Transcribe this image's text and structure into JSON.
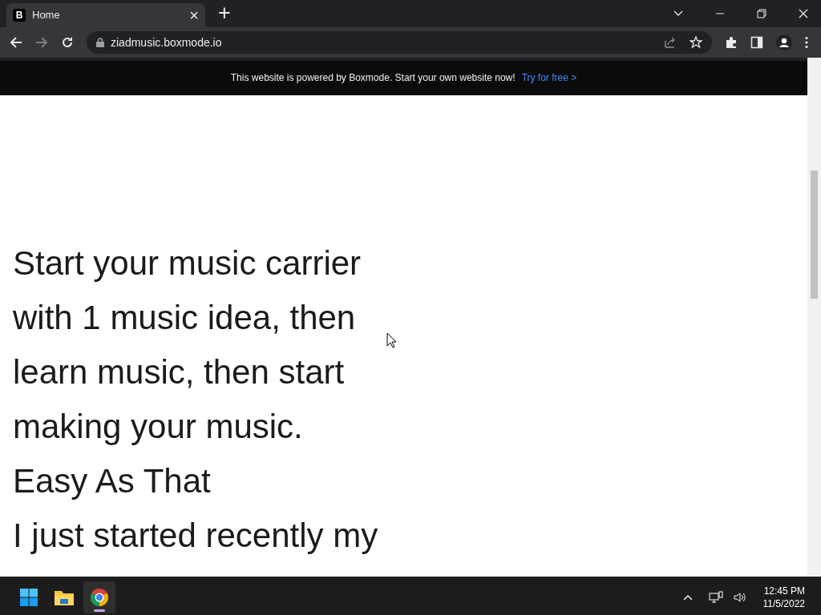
{
  "browser": {
    "tab": {
      "favicon": "B",
      "title": "Home",
      "close": "×"
    },
    "new_tab": "+",
    "url": "ziadmusic.boxmode.io"
  },
  "banner": {
    "text": "This website is powered by Boxmode. Start your own website now!",
    "link": "Try for free >"
  },
  "content": {
    "paragraphs": [
      "Start your music carrier with 1 music idea, then learn music, then start making your music. Easy As That",
      "I just started recently my"
    ]
  },
  "taskbar": {
    "apps": [
      {
        "kind": "start",
        "selected": false
      },
      {
        "kind": "folder",
        "selected": false
      },
      {
        "kind": "browser",
        "selected": true
      }
    ],
    "time": "12:45 PM",
    "date": "11/5/2022"
  }
}
